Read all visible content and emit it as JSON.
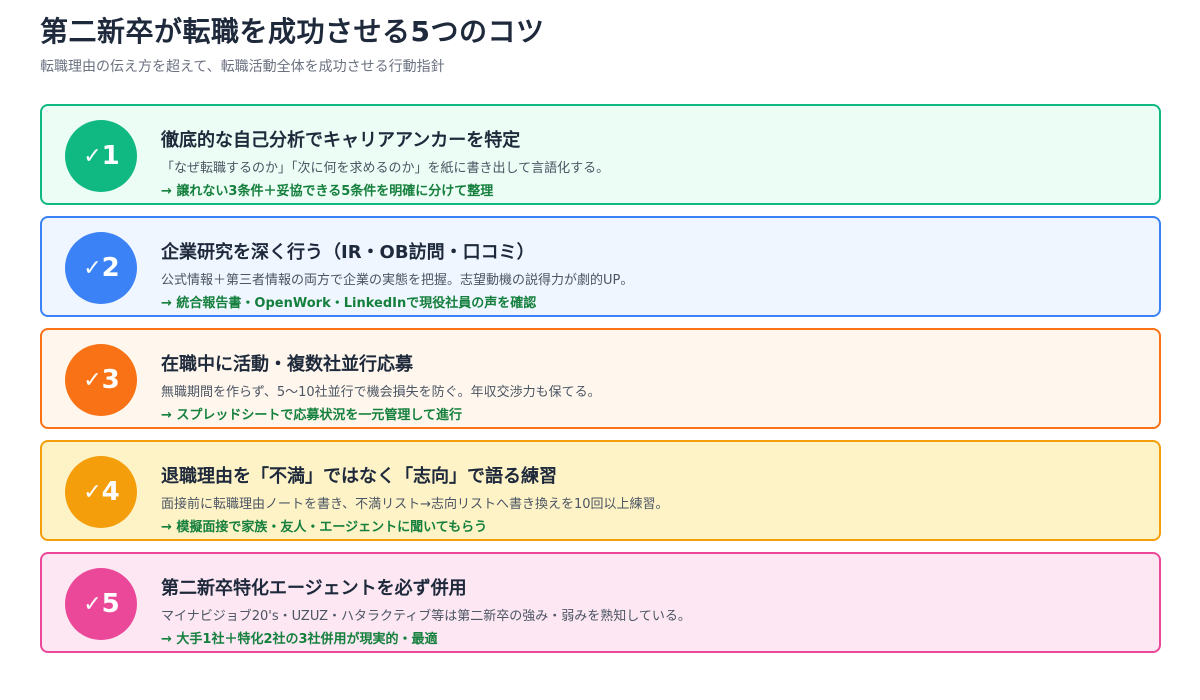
{
  "page": {
    "title": "第二新卒が転職を成功させる5つのコツ",
    "subtitle": "転職理由の伝え方を超えて、転職活動全体を成功させる行動指針"
  },
  "tips": [
    {
      "check": "✓",
      "number": "1",
      "title": "徹底的な自己分析でキャリアアンカーを特定",
      "description": "「なぜ転職するのか」「次に何を求めるのか」を紙に書き出して言語化する。",
      "action": "→ 譲れない3条件＋妥協できる5条件を明確に分けて整理",
      "border_color": "#10b981",
      "bg_color": "#ecfdf5",
      "badge_color": "#10b981"
    },
    {
      "check": "✓",
      "number": "2",
      "title": "企業研究を深く行う（IR・OB訪問・口コミ）",
      "description": "公式情報＋第三者情報の両方で企業の実態を把握。志望動機の説得力が劇的UP。",
      "action": "→ 統合報告書・OpenWork・LinkedInで現役社員の声を確認",
      "border_color": "#3b82f6",
      "bg_color": "#eff6ff",
      "badge_color": "#3b82f6"
    },
    {
      "check": "✓",
      "number": "3",
      "title": "在職中に活動・複数社並行応募",
      "description": "無職期間を作らず、5〜10社並行で機会損失を防ぐ。年収交渉力も保てる。",
      "action": "→ スプレッドシートで応募状況を一元管理して進行",
      "border_color": "#f97316",
      "bg_color": "#fff7ed",
      "badge_color": "#f97316"
    },
    {
      "check": "✓",
      "number": "4",
      "title": "退職理由を「不満」ではなく「志向」で語る練習",
      "description": "面接前に転職理由ノートを書き、不満リスト→志向リストへ書き換えを10回以上練習。",
      "action": "→ 模擬面接で家族・友人・エージェントに聞いてもらう",
      "border_color": "#f59e0b",
      "bg_color": "#fef3c7",
      "badge_color": "#f59e0b"
    },
    {
      "check": "✓",
      "number": "5",
      "title": "第二新卒特化エージェントを必ず併用",
      "description": "マイナビジョブ20's・UZUZ・ハタラクティブ等は第二新卒の強み・弱みを熟知している。",
      "action": "→ 大手1社＋特化2社の3社併用が現実的・最適",
      "border_color": "#ec4899",
      "bg_color": "#fce7f3",
      "badge_color": "#ec4899"
    }
  ]
}
